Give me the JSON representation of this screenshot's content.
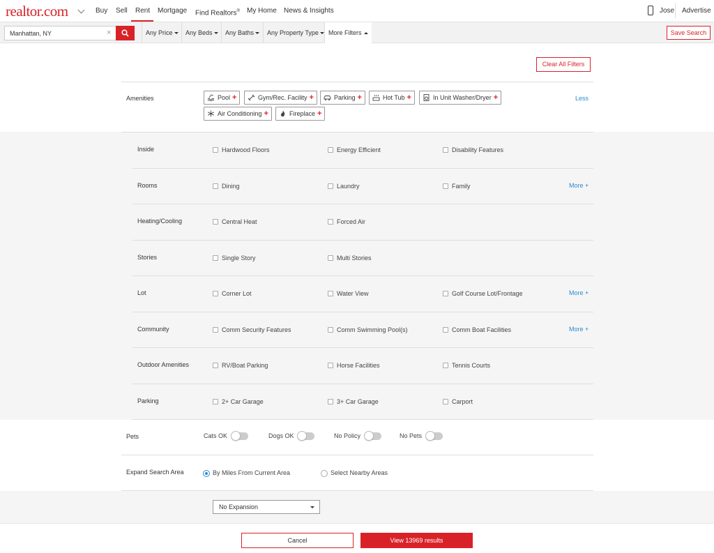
{
  "nav": {
    "logo": "realtor.com",
    "links": [
      "Buy",
      "Sell",
      "Rent",
      "Mortgage",
      "Find Realtors",
      "My Home",
      "News & Insights"
    ],
    "find_realtors_mark": "®",
    "active_link": "Rent",
    "user": "Jose",
    "advertise": "Advertise"
  },
  "filters": {
    "search_value": "Manhattan, NY",
    "clear": "×",
    "price": "Any Price",
    "beds": "Any Beds",
    "baths": "Any Baths",
    "property_type": "Any Property Type",
    "more_filters": "More Filters",
    "save_search": "Save Search"
  },
  "panel": {
    "clear_all": "Clear All Filters",
    "amenities": {
      "label": "Amenities",
      "chips": [
        "Pool",
        "Gym/Rec. Facility",
        "Parking",
        "Hot Tub",
        "In Unit Washer/Dryer",
        "Air Conditioning",
        "Fireplace"
      ],
      "plus": "+",
      "less": "Less"
    },
    "groups": [
      {
        "label": "Inside",
        "options": [
          "Hardwood Floors",
          "Energy Efficient",
          "Disability Features"
        ],
        "more": ""
      },
      {
        "label": "Rooms",
        "options": [
          "Dining",
          "Laundry",
          "Family"
        ],
        "more": "More +"
      },
      {
        "label": "Heating/Cooling",
        "options": [
          "Central Heat",
          "Forced Air"
        ],
        "more": ""
      },
      {
        "label": "Stories",
        "options": [
          "Single Story",
          "Multi Stories"
        ],
        "more": ""
      },
      {
        "label": "Lot",
        "options": [
          "Corner Lot",
          "Water View",
          "Golf Course Lot/Frontage"
        ],
        "more": "More +"
      },
      {
        "label": "Community",
        "options": [
          "Comm Security Features",
          "Comm Swimming Pool(s)",
          "Comm Boat Facilities"
        ],
        "more": "More +"
      },
      {
        "label": "Outdoor Amenities",
        "options": [
          "RV/Boat Parking",
          "Horse Facilities",
          "Tennis Courts"
        ],
        "more": ""
      },
      {
        "label": "Parking",
        "options": [
          "2+ Car Garage",
          "3+ Car Garage",
          "Carport"
        ],
        "more": ""
      }
    ],
    "pets": {
      "label": "Pets",
      "options": [
        "Cats OK",
        "Dogs OK",
        "No Policy",
        "No Pets"
      ]
    },
    "expand": {
      "label": "Expand Search Area",
      "options": [
        "By Miles From Current Area",
        "Select Nearby Areas"
      ],
      "selected": "By Miles From Current Area",
      "dropdown_value": "No Expansion"
    }
  },
  "footer": {
    "cancel": "Cancel",
    "view": "View 13969 results"
  },
  "colors": {
    "brand": "#d92228",
    "link": "#2a8ad4",
    "band": "#f5f5f5"
  }
}
